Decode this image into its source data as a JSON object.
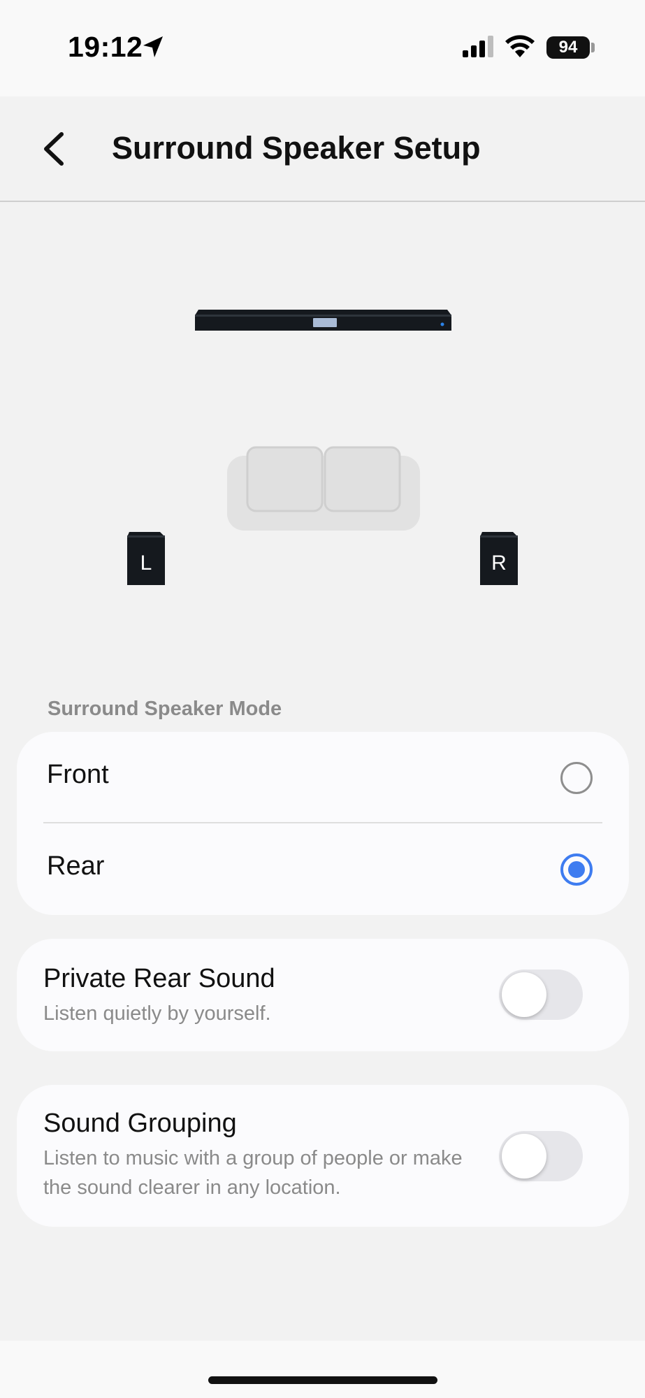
{
  "status_bar": {
    "time": "19:12",
    "battery": "94",
    "icons": [
      "location-arrow-icon",
      "signal-icon",
      "wifi-icon",
      "battery-icon"
    ]
  },
  "header": {
    "title": "Surround Speaker Setup",
    "back_icon": "chevron-left-icon"
  },
  "illustration": {
    "left_speaker_label": "L",
    "right_speaker_label": "R",
    "soundbar_accent": "#a9bbd6",
    "led_color": "#2b83e8"
  },
  "surround_mode": {
    "section_label": "Surround Speaker Mode",
    "options": [
      {
        "label": "Front",
        "selected": false
      },
      {
        "label": "Rear",
        "selected": true
      }
    ]
  },
  "private_rear_sound": {
    "title": "Private Rear Sound",
    "description": "Listen quietly by yourself.",
    "enabled": false
  },
  "sound_grouping": {
    "title": "Sound Grouping",
    "description": "Listen to music with a group of people or make the sound clearer in any location.",
    "enabled": false
  },
  "colors": {
    "accent": "#3e7cf0",
    "background": "#f2f2f2",
    "card": "#fbfbfd",
    "secondary_text": "#8a8a8a"
  }
}
